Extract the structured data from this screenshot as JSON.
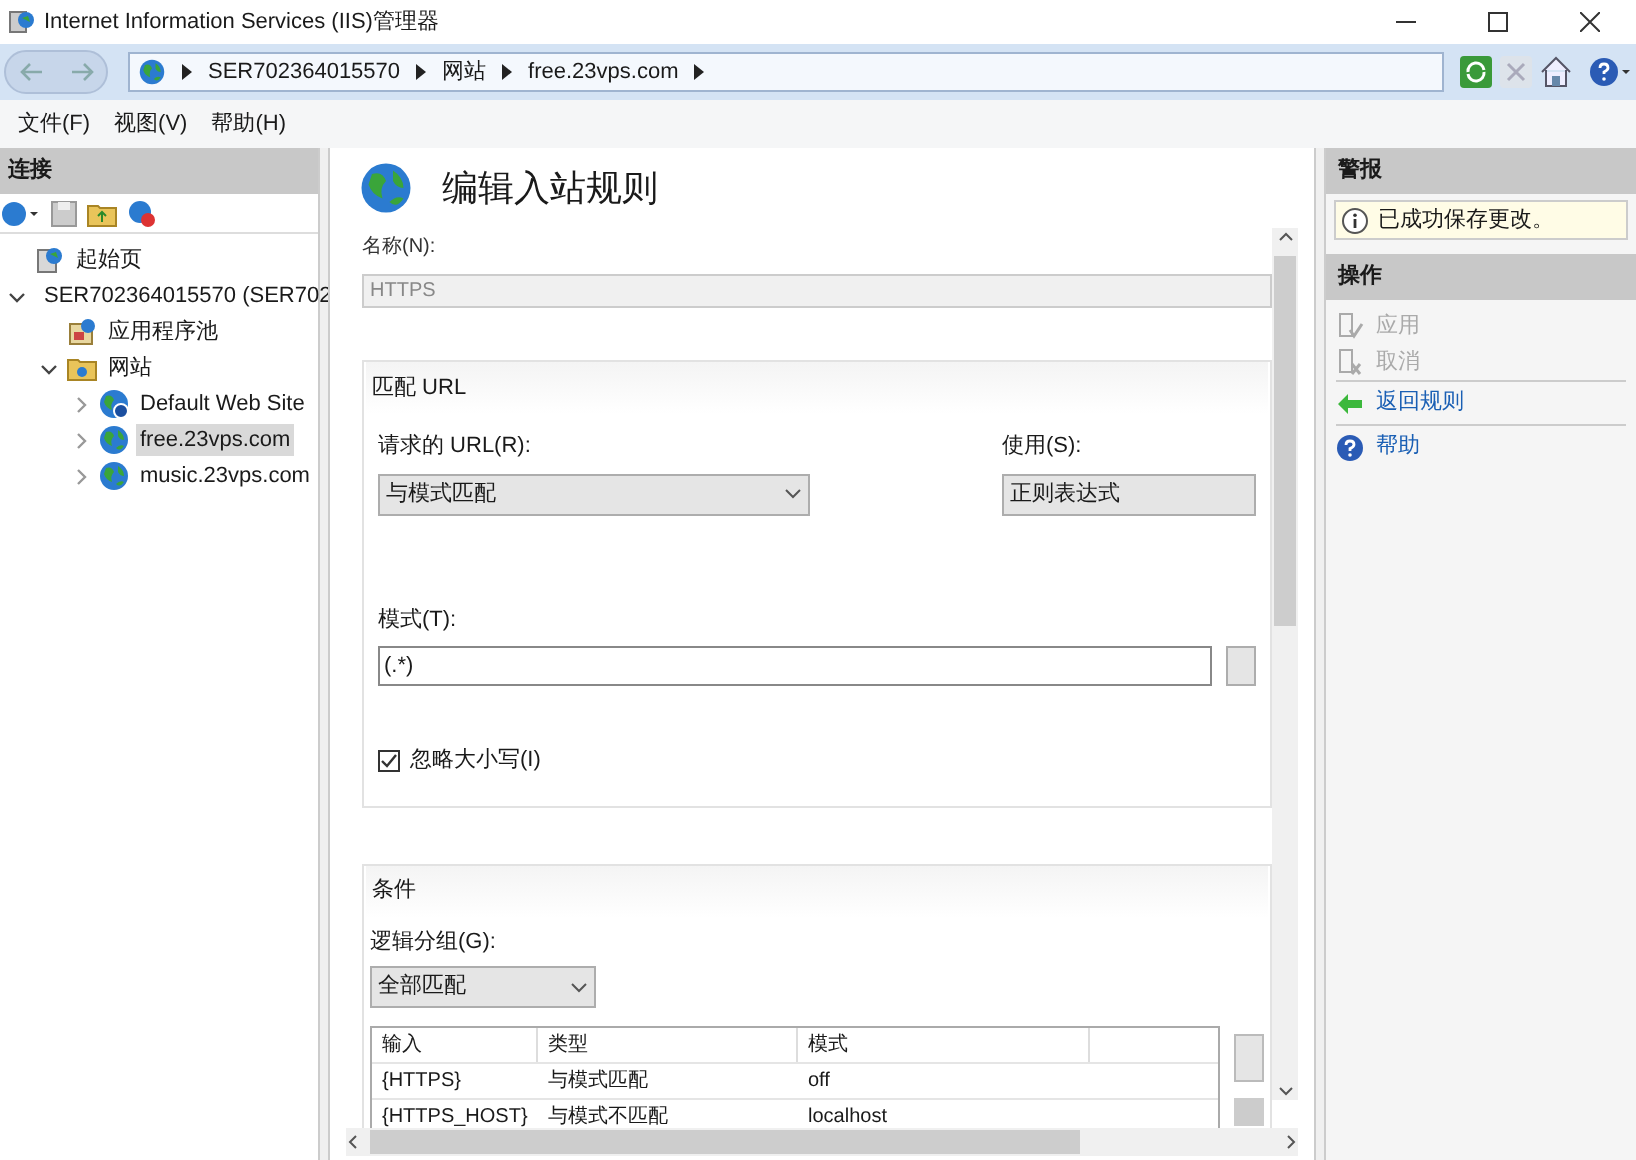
{
  "window": {
    "title": "Internet Information Services (IIS)管理器"
  },
  "breadcrumb": [
    "SER702364015570",
    "网站",
    "free.23vps.com"
  ],
  "menu": [
    "文件(F)",
    "视图(V)",
    "帮助(H)"
  ],
  "connections": {
    "title": "连接",
    "tree": [
      {
        "label": "起始页",
        "kind": "start",
        "selected": false
      },
      {
        "label": "SER702364015570 (SER702",
        "kind": "server",
        "expanded": true,
        "selected": false,
        "children": [
          {
            "label": "应用程序池",
            "kind": "pool",
            "selected": false
          },
          {
            "label": "网站",
            "kind": "folder",
            "expanded": true,
            "selected": false,
            "children": [
              {
                "label": "Default Web Site",
                "kind": "site",
                "expanded": false,
                "selected": false
              },
              {
                "label": "free.23vps.com",
                "kind": "globe",
                "expanded": false,
                "selected": true
              },
              {
                "label": "music.23vps.com",
                "kind": "globe",
                "expanded": false,
                "selected": false
              }
            ]
          }
        ]
      }
    ]
  },
  "page": {
    "title": "编辑入站规则",
    "name_label": "名称(N):",
    "name_value": "HTTPS",
    "match_url": {
      "title": "匹配 URL",
      "requested_label": "请求的 URL(R):",
      "requested_value": "与模式匹配",
      "using_label": "使用(S):",
      "using_value": "正则表达式",
      "pattern_label": "模式(T):",
      "pattern_value": "(.*)",
      "ignore_case": {
        "label": "忽略大小写(I)",
        "checked": true
      }
    },
    "conditions": {
      "title": "条件",
      "grouping_label": "逻辑分组(G):",
      "grouping_value": "全部匹配",
      "columns": [
        "输入",
        "类型",
        "模式"
      ],
      "rows": [
        [
          "{HTTPS}",
          "与模式匹配",
          "off"
        ],
        [
          "{HTTPS_HOST}",
          "与模式不匹配",
          "localhost"
        ]
      ]
    }
  },
  "alerts": {
    "title": "警报",
    "message": "已成功保存更改。"
  },
  "actions": {
    "title": "操作",
    "items": [
      {
        "label": "应用",
        "kind": "apply",
        "disabled": true
      },
      {
        "label": "取消",
        "kind": "cancel",
        "disabled": true
      },
      {
        "label": "返回规则",
        "kind": "back",
        "disabled": false
      },
      {
        "label": "帮助",
        "kind": "help",
        "disabled": false
      }
    ]
  }
}
